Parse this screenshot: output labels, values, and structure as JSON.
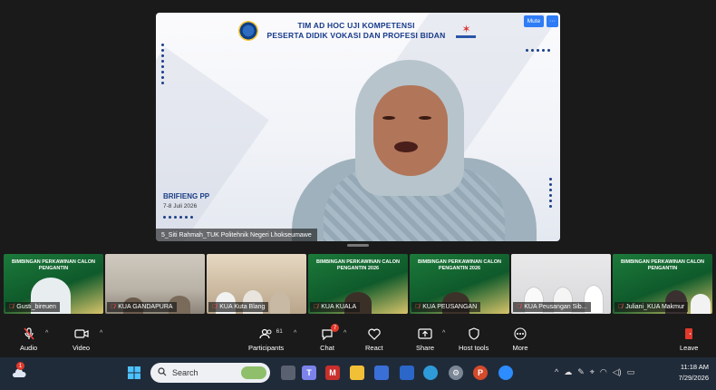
{
  "speaker": {
    "header_title_line1": "TIM AD HOC UJI KOMPETENSI",
    "header_title_line2": "PESERTA DIDIK VOKASI DAN PROFESI BIDAN",
    "mute_label": "Mute",
    "more_label": "···",
    "brief_title": "BRIFIENG PP",
    "brief_date": "7-8 Juli 2026",
    "name": "5_Siti Rahmah_TUK Politehnik Negeri Lhokseumawe"
  },
  "thumbnails": [
    {
      "name": "Gusti_bireuen",
      "muted": true,
      "style": "green",
      "banner": "BIMBINGAN PERKAWINAN CALON PENGANTIN"
    },
    {
      "name": "KUA GANDAPURA",
      "muted": true,
      "style": "room",
      "banner": ""
    },
    {
      "name": "KUA Kuta Blang",
      "muted": true,
      "style": "room",
      "banner": ""
    },
    {
      "name": "KUA KUALA",
      "muted": true,
      "style": "green",
      "banner": "BIMBINGAN PERKAWINAN CALON PENGANTIN 2026"
    },
    {
      "name": "KUA PEUSANGAN",
      "muted": true,
      "style": "green",
      "banner": "BIMBINGAN PERKAWINAN CALON PENGANTIN 2026"
    },
    {
      "name": "KUA Peusangan Sib...",
      "muted": true,
      "style": "white",
      "banner": ""
    },
    {
      "name": "Juliani_KUA Makmur",
      "muted": true,
      "style": "green",
      "banner": "BIMBINGAN PERKAWINAN CALON PENGANTIN"
    }
  ],
  "toolbar": {
    "audio": "Audio",
    "video": "Video",
    "participants": "Participants",
    "participants_count": "61",
    "chat": "Chat",
    "chat_badge": "7",
    "react": "React",
    "share": "Share",
    "host_tools": "Host tools",
    "more": "More",
    "leave": "Leave"
  },
  "taskbar": {
    "search_placeholder": "Search",
    "time": "11:18 AM",
    "date": "7/29/2026",
    "weather_badge": "1"
  },
  "colors": {
    "accent_blue": "#2e7cf6",
    "muted_red": "#ff5050",
    "taskbar": "#202b3a"
  }
}
